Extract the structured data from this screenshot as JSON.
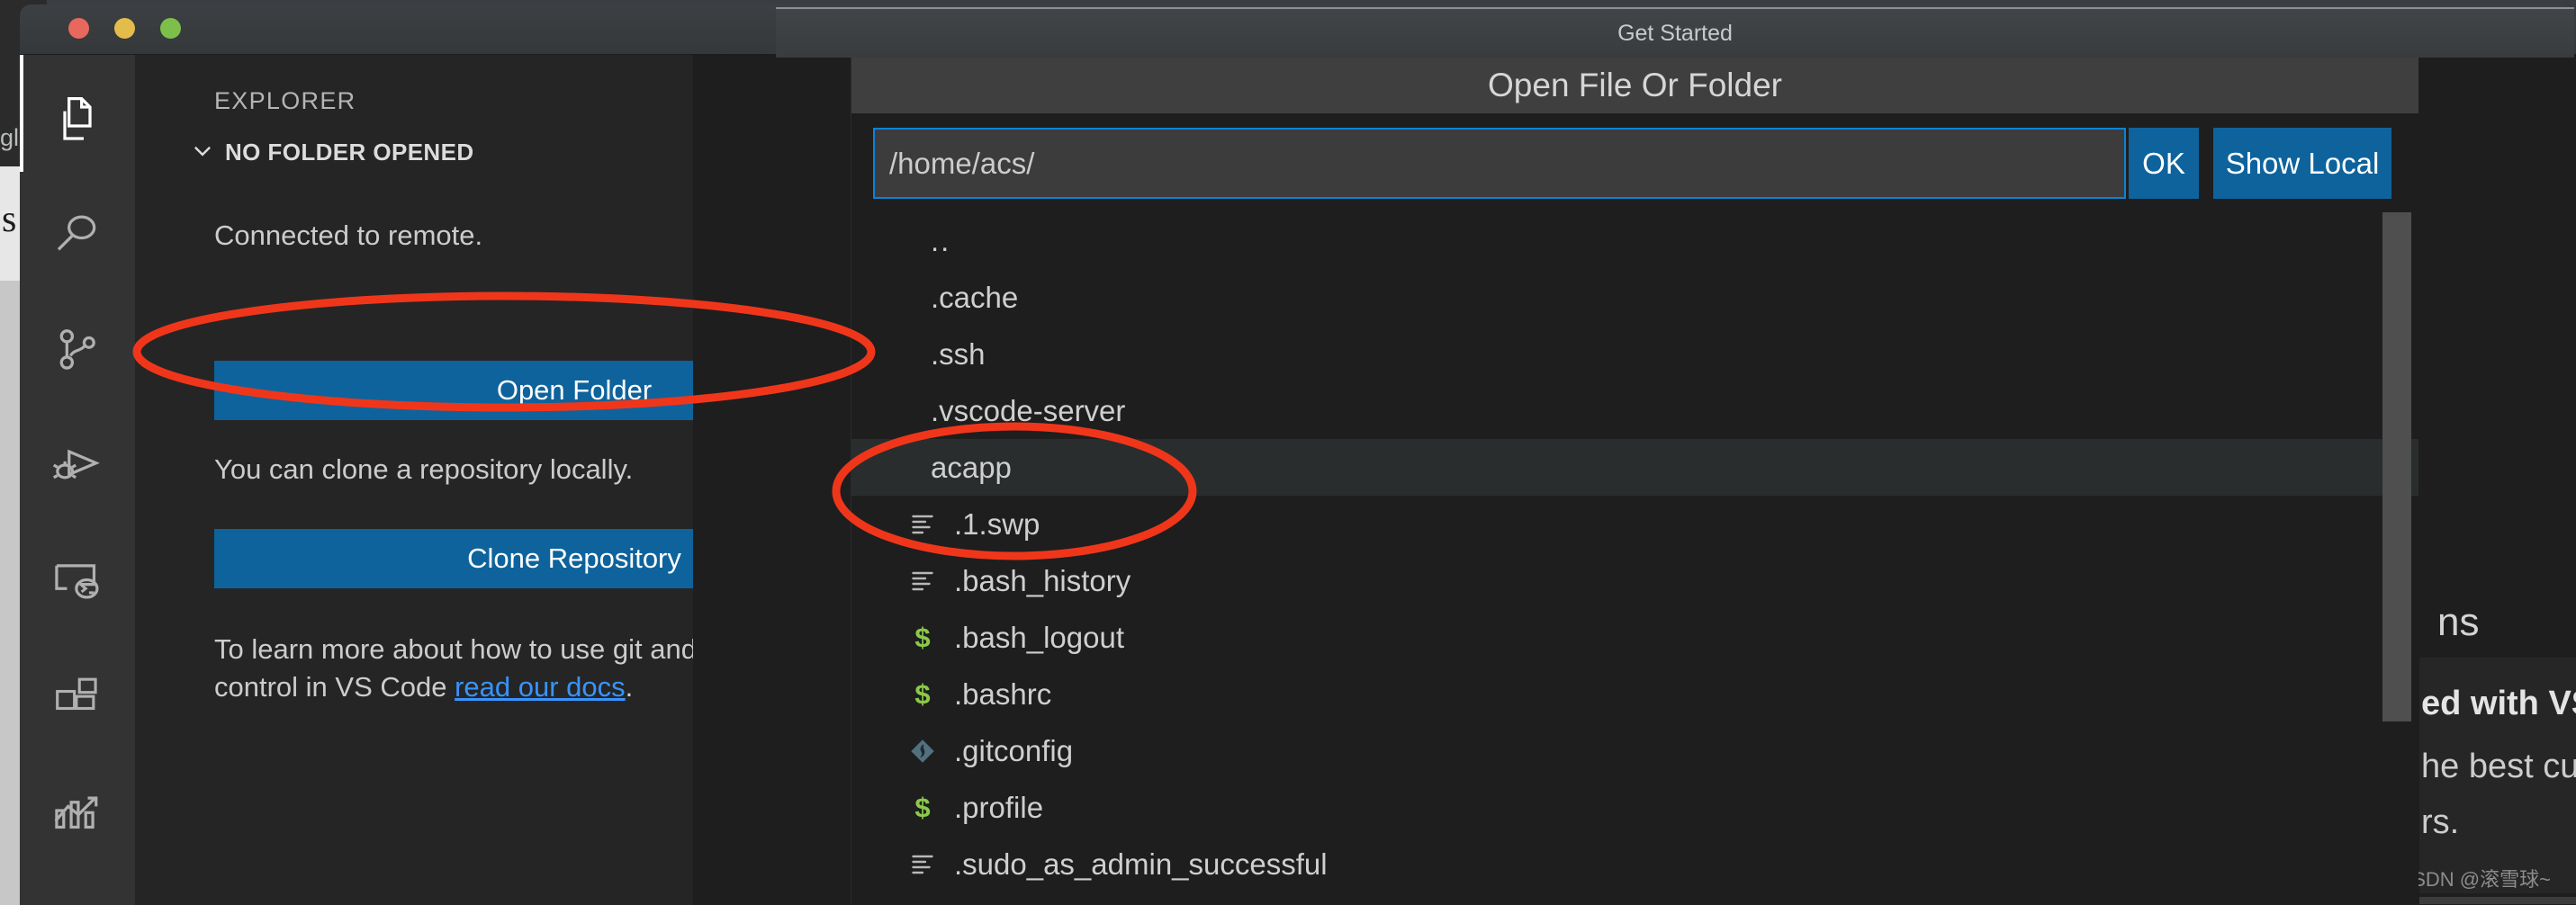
{
  "window": {
    "title": "Get Started",
    "traffic_lights": [
      "close",
      "minimize",
      "maximize"
    ],
    "colors": {
      "accent": "#0e639c",
      "link": "#3794ff",
      "annotation": "#f0361a",
      "focus_border": "#0a84d8"
    }
  },
  "activity_bar": {
    "items": [
      {
        "name": "explorer",
        "icon": "files-icon",
        "active": true
      },
      {
        "name": "search",
        "icon": "search-icon",
        "active": false
      },
      {
        "name": "source-control",
        "icon": "source-control-icon",
        "active": false
      },
      {
        "name": "run-and-debug",
        "icon": "run-debug-icon",
        "active": false
      },
      {
        "name": "remote-explorer",
        "icon": "remote-explorer-icon",
        "active": false
      },
      {
        "name": "extensions",
        "icon": "extensions-icon",
        "active": false
      },
      {
        "name": "analytics",
        "icon": "analytics-icon",
        "active": false
      }
    ]
  },
  "sidebar": {
    "title": "EXPLORER",
    "section": {
      "label": "NO FOLDER OPENED",
      "expanded": true
    },
    "connected_text": "Connected to remote.",
    "open_folder_button": "Open Folder",
    "clone_hint": "You can clone a repository locally.",
    "clone_button": "Clone Repository",
    "learn_more_prefix": "To learn more about how to use git and source control in VS Code ",
    "learn_more_link": "read our docs",
    "learn_more_suffix": "."
  },
  "editor_behind": {
    "fragment_ns": "ns",
    "line1": "ed with VS",
    "line2": "he best cus",
    "line3": "rs.",
    "watermark": "CSDN @滚雪球~"
  },
  "dialog": {
    "header": "Open File Or Folder",
    "path_value": "/home/acs/",
    "path_placeholder": "/home/acs/",
    "ok_button": "OK",
    "show_local_button": "Show Local",
    "files": [
      {
        "name": "..",
        "icon": "none",
        "indent": false,
        "selected": false
      },
      {
        "name": ".cache",
        "icon": "none",
        "indent": false,
        "selected": false
      },
      {
        "name": ".ssh",
        "icon": "none",
        "indent": false,
        "selected": false
      },
      {
        "name": ".vscode-server",
        "icon": "none",
        "indent": false,
        "selected": false
      },
      {
        "name": "acapp",
        "icon": "none",
        "indent": false,
        "selected": true
      },
      {
        "name": ".1.swp",
        "icon": "text-icon",
        "indent": true,
        "selected": false
      },
      {
        "name": ".bash_history",
        "icon": "text-icon",
        "indent": true,
        "selected": false
      },
      {
        "name": ".bash_logout",
        "icon": "shell-icon",
        "indent": true,
        "selected": false
      },
      {
        "name": ".bashrc",
        "icon": "shell-icon",
        "indent": true,
        "selected": false
      },
      {
        "name": ".gitconfig",
        "icon": "git-icon",
        "indent": true,
        "selected": false
      },
      {
        "name": ".profile",
        "icon": "shell-icon",
        "indent": true,
        "selected": false
      },
      {
        "name": ".sudo_as_admin_successful",
        "icon": "text-icon",
        "indent": true,
        "selected": false
      }
    ]
  },
  "annotations": [
    {
      "name": "highlight-open-folder",
      "shape": "ellipse"
    },
    {
      "name": "highlight-acapp-entry",
      "shape": "ellipse"
    }
  ]
}
